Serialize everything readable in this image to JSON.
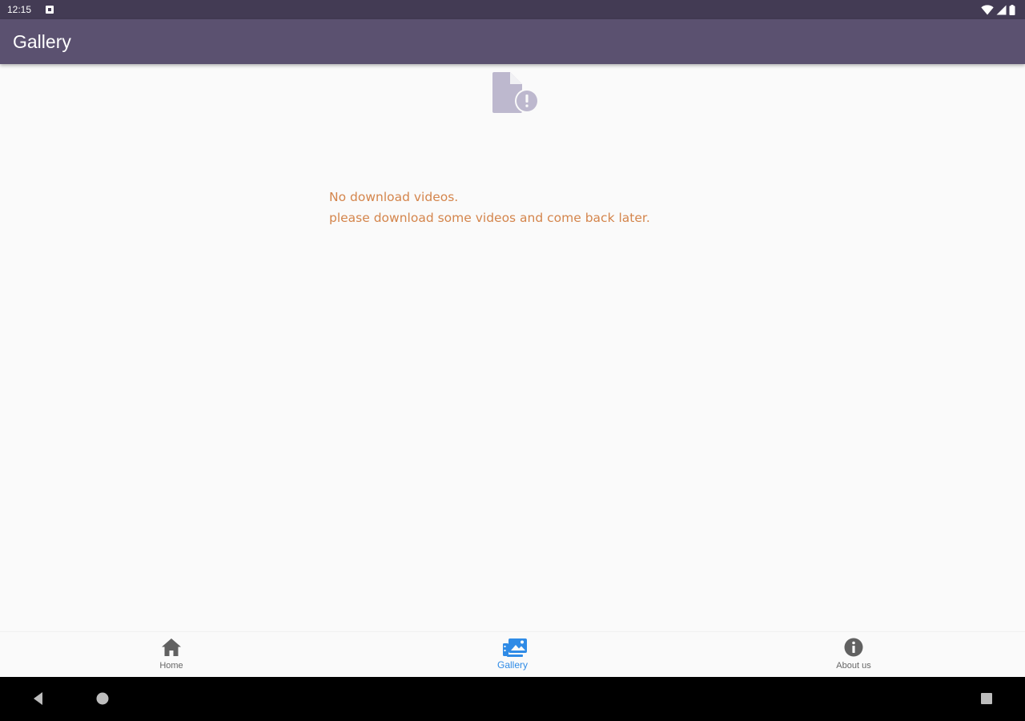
{
  "status_bar": {
    "time": "12:15",
    "icons": [
      "notification-icon",
      "wifi-icon",
      "signal-icon",
      "battery-icon"
    ]
  },
  "app_bar": {
    "title": "Gallery",
    "background": "#5b5170"
  },
  "empty_state": {
    "icon": "file-alert-icon",
    "line1": "No download videos.",
    "line2": "please download some videos and come back later.",
    "text_color": "#d4854c"
  },
  "bottom_nav": {
    "active_color": "#2f8be6",
    "items": [
      {
        "label": "Home",
        "icon": "home-icon",
        "active": false
      },
      {
        "label": "Gallery",
        "icon": "gallery-icon",
        "active": true
      },
      {
        "label": "About us",
        "icon": "info-icon",
        "active": false
      }
    ]
  },
  "system_nav": {
    "buttons": [
      "back-icon",
      "home-circle-icon",
      "recents-icon"
    ]
  }
}
